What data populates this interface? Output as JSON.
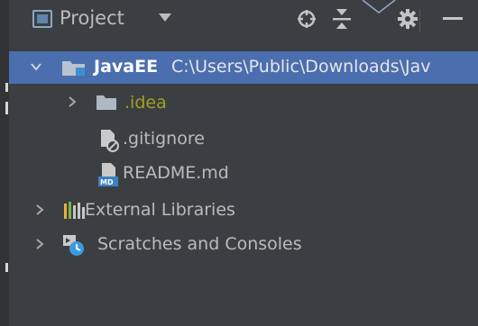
{
  "panel": {
    "title": "Project"
  },
  "toolbar": {
    "icons": [
      "locate-icon",
      "collapse-all-icon",
      "gear-icon",
      "minimize-icon"
    ]
  },
  "tree": {
    "root": {
      "name": "JavaEE",
      "path": "C:\\Users\\Public\\Downloads\\Jav",
      "expanded": true
    },
    "children": [
      {
        "name": ".idea",
        "type": "folder",
        "expanded": false
      },
      {
        "name": ".gitignore",
        "type": "file"
      },
      {
        "name": "README.md",
        "type": "file",
        "icon_text": "MD"
      }
    ],
    "external_libraries": "External Libraries",
    "scratches": "Scratches and Consoles"
  },
  "colors": {
    "panel_bg": "#3c3f41",
    "selection": "#4b6eaf",
    "idea_folder_text": "#a0a020"
  }
}
